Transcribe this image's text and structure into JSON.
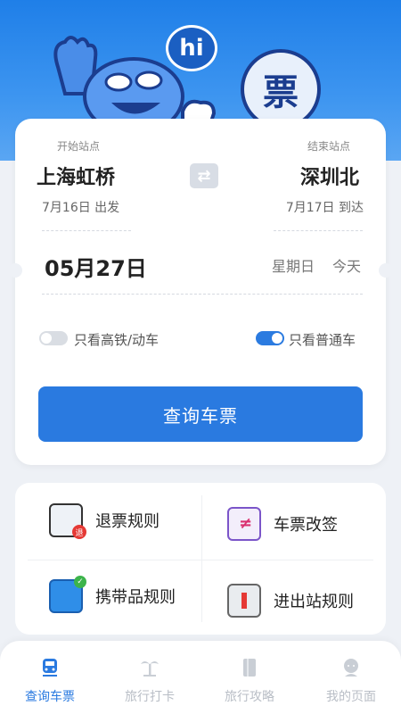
{
  "hero": {
    "bubble_text": "hi",
    "badge_text": "票"
  },
  "search": {
    "from_label": "开始站点",
    "to_label": "结束站点",
    "from_station": "上海虹桥",
    "to_station": "深圳北",
    "from_date": "7月16日 出发",
    "to_date": "7月17日 到达",
    "travel_date": "05月27日",
    "weekday": "星期日",
    "today_label": "今天",
    "option_highspeed": {
      "label": "只看高铁/动车",
      "checked": false
    },
    "option_normal": {
      "label": "只看普通车",
      "checked": true
    },
    "submit_label": "查询车票"
  },
  "rules": [
    {
      "label": "退票规则",
      "icon": "refund-rules-icon"
    },
    {
      "label": "车票改签",
      "icon": "ticket-change-icon"
    },
    {
      "label": "携带品规则",
      "icon": "luggage-icon"
    },
    {
      "label": "进出站规则",
      "icon": "station-gate-icon"
    }
  ],
  "tabs": [
    {
      "label": "查询车票",
      "icon": "train-icon",
      "active": true
    },
    {
      "label": "旅行打卡",
      "icon": "palm-tree-icon",
      "active": false
    },
    {
      "label": "旅行攻略",
      "icon": "book-icon",
      "active": false
    },
    {
      "label": "我的页面",
      "icon": "user-icon",
      "active": false
    }
  ],
  "colors": {
    "accent": "#2a7ae0",
    "hero_top": "#1f7fe8",
    "inactive_tab": "#b9bec6"
  }
}
